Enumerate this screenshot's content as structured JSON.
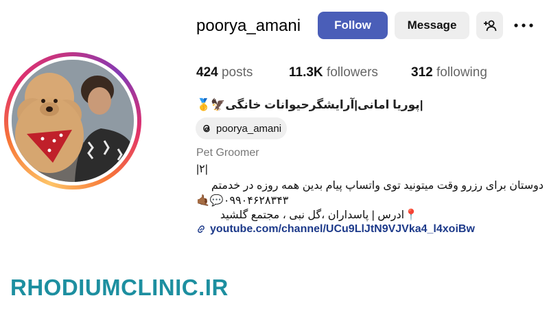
{
  "profile": {
    "username": "poorya_amani",
    "follow_label": "Follow",
    "message_label": "Message",
    "stats": {
      "posts_count": "424",
      "posts_label": "posts",
      "followers_count": "11.3K",
      "followers_label": "followers",
      "following_count": "312",
      "following_label": "following"
    },
    "full_name": "🥇🦅پوریا امانی|آرایشگرحیوانات خانگی|",
    "threads_handle": "poorya_amani",
    "category": "Pet Groomer",
    "bio_lines": [
      "|۲|",
      "دوستان برای رزرو وقت میتونید توی واتساپ پیام بدین همه روزه در خدمتم",
      "🤙🏾💬۰۹۹۰۴۶۲۸۳۴۳",
      "📍ادرس | پاسداران ،گل نبی ، مجتمع گلشید"
    ],
    "link_text": "youtube.com/channel/UCu9LlJtN9VJVka4_l4xoiBw"
  },
  "watermark": "RHODIUMCLINIC.IR",
  "colors": {
    "follow_button": "#4a5eb8",
    "secondary_button": "#eeeeee",
    "link": "#1d3a8a",
    "watermark": "#1d8fa0"
  },
  "icons": [
    "add-user-icon",
    "more-options-icon",
    "threads-icon",
    "link-icon"
  ]
}
